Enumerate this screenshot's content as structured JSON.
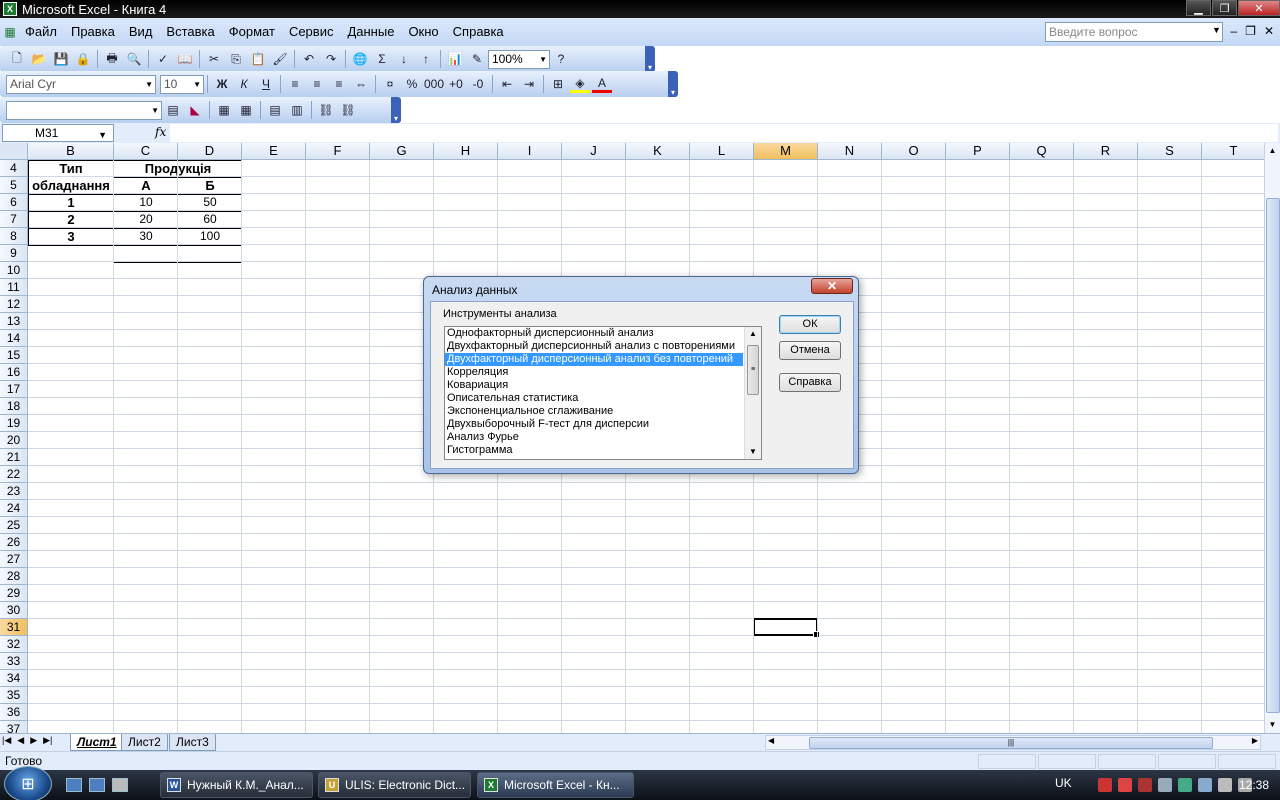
{
  "window": {
    "title": "Microsoft Excel - Книга 4",
    "app_icon": "X"
  },
  "menu": {
    "items": [
      "Файл",
      "Правка",
      "Вид",
      "Вставка",
      "Формат",
      "Сервис",
      "Данные",
      "Окно",
      "Справка"
    ],
    "ask_placeholder": "Введите вопрос"
  },
  "toolbar": {
    "zoom": "100%",
    "font_name": "Arial Cyr",
    "font_size": "10",
    "style_box": ""
  },
  "formula": {
    "name_box": "M31",
    "fx": "fx",
    "value": ""
  },
  "columns": [
    "B",
    "C",
    "D",
    "E",
    "F",
    "G",
    "H",
    "I",
    "J",
    "K",
    "L",
    "M",
    "N",
    "O",
    "P",
    "Q",
    "R",
    "S",
    "T"
  ],
  "selected_column": "M",
  "rows": [
    "4",
    "5",
    "6",
    "7",
    "8",
    "9",
    "10",
    "11",
    "12",
    "13",
    "14",
    "15",
    "16",
    "17",
    "18",
    "19",
    "20",
    "21",
    "22",
    "23",
    "24",
    "25",
    "26",
    "27",
    "28",
    "29",
    "30",
    "31",
    "32",
    "33",
    "34",
    "35",
    "36",
    "37"
  ],
  "selected_row": "31",
  "table": {
    "b_header_1": "Тип",
    "b_header_2": "обладнання",
    "c_header": "Продукція",
    "col_a": "А",
    "col_b": "Б",
    "r6": [
      "1",
      "10",
      "50"
    ],
    "r7": [
      "2",
      "20",
      "60"
    ],
    "r8": [
      "3",
      "30",
      "100"
    ]
  },
  "sheets": [
    "Лист1",
    "Лист2",
    "Лист3"
  ],
  "status": "Готово",
  "dialog": {
    "title": "Анализ данных",
    "close": "✕",
    "group_label": "Инструменты анализа",
    "items": [
      "Однофакторный дисперсионный анализ",
      "Двухфакторный дисперсионный анализ с повторениями",
      "Двухфакторный дисперсионный анализ без повторений",
      "Корреляция",
      "Ковариация",
      "Описательная статистика",
      "Экспоненциальное сглаживание",
      "Двухвыборочный F-тест для дисперсии",
      "Анализ Фурье",
      "Гистограмма"
    ],
    "selected_index": 2,
    "ok": "ОК",
    "cancel": "Отмена",
    "help": "Справка"
  },
  "taskbar": {
    "tasks": [
      "Нужный К.М._Анал...",
      "ULIS: Electronic Dict...",
      "Microsoft Excel - Кн..."
    ],
    "active_task": 2,
    "lang": "UK",
    "time": "12:38"
  },
  "colors": {
    "accent": "#3399ff",
    "selected_header": "#f1c05f",
    "toolbar": "#c4d8f5"
  }
}
